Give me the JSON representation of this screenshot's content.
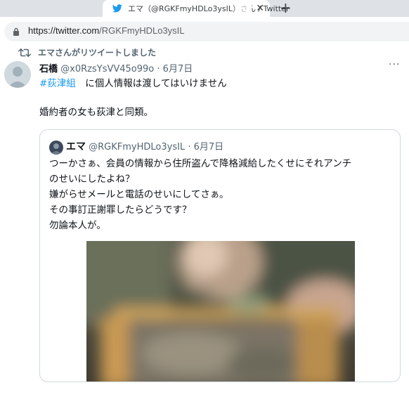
{
  "browser": {
    "tab_title": "エマ（@RGKFmyHDLo3ysIL）さん / Twitter",
    "url_host": "https://twitter.com",
    "url_path": "/RGKFmyHDLo3ysIL",
    "close_symbol": "✕",
    "new_tab_symbol": "+",
    "favicon": "twitter-bird-icon",
    "accent_color": "#1d9bf0"
  },
  "retweet": {
    "label": "エマさんがリツイートしました",
    "icon": "retweet-icon"
  },
  "tweet": {
    "author_name": "石橋",
    "author_handle": "@x0RzsYsVV45o99o",
    "separator": "·",
    "date": "6月7日",
    "hashtag": "#荻津組",
    "line1_rest": "　に個人情報は渡してはいけません",
    "line2": "婚約者の女も荻津と同類。",
    "more": "···"
  },
  "quote": {
    "author_name": "エマ",
    "author_handle": "@RGKFmyHDLo3ysIL",
    "separator": "·",
    "date": "6月7日",
    "lines": [
      "つーかさぁ、会員の情報から住所盗んで降格減給したくせにそれアンチ",
      "のせいにしたよね？",
      "嫌がらせメールと電話のせいにしてさぁ。",
      "その事訂正謝罪したらどうです？",
      "勿論本人が。"
    ],
    "media": "blurred-photo"
  }
}
